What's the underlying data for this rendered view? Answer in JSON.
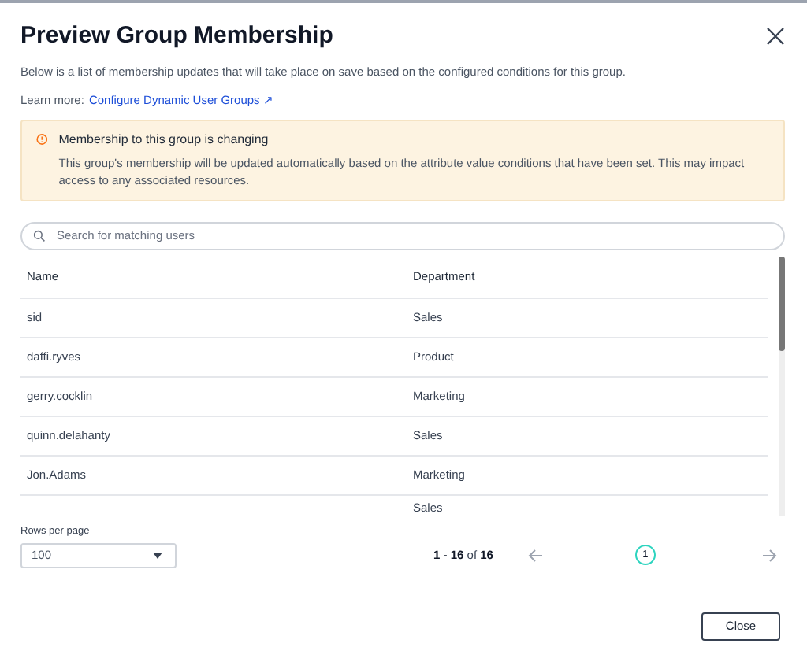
{
  "dialog": {
    "title": "Preview Group Membership",
    "description": "Below is a list of membership updates that will take place on save based on the configured conditions for this group.",
    "learn_more_label": "Learn more:",
    "learn_more_link": "Configure Dynamic User Groups ↗"
  },
  "alert": {
    "title": "Membership to this group is changing",
    "message": "This group's membership will be updated automatically based on the attribute value conditions that have been set. This may impact access to any associated resources."
  },
  "search": {
    "placeholder": "Search for matching users"
  },
  "table": {
    "columns": [
      "Name",
      "Department"
    ],
    "rows": [
      {
        "name": "sid",
        "department": "Sales"
      },
      {
        "name": "daffi.ryves",
        "department": "Product"
      },
      {
        "name": "gerry.cocklin",
        "department": "Marketing"
      },
      {
        "name": "quinn.delahanty",
        "department": "Sales"
      },
      {
        "name": "Jon.Adams",
        "department": "Marketing"
      },
      {
        "department": "Sales"
      }
    ]
  },
  "pagination": {
    "rows_per_page_label": "Rows per page",
    "rows_per_page": "100",
    "range": "**1 - 16** of **16**",
    "pages": [
      {
        "label": "1",
        "selected": true
      }
    ]
  },
  "buttons": [
    "Close"
  ]
}
